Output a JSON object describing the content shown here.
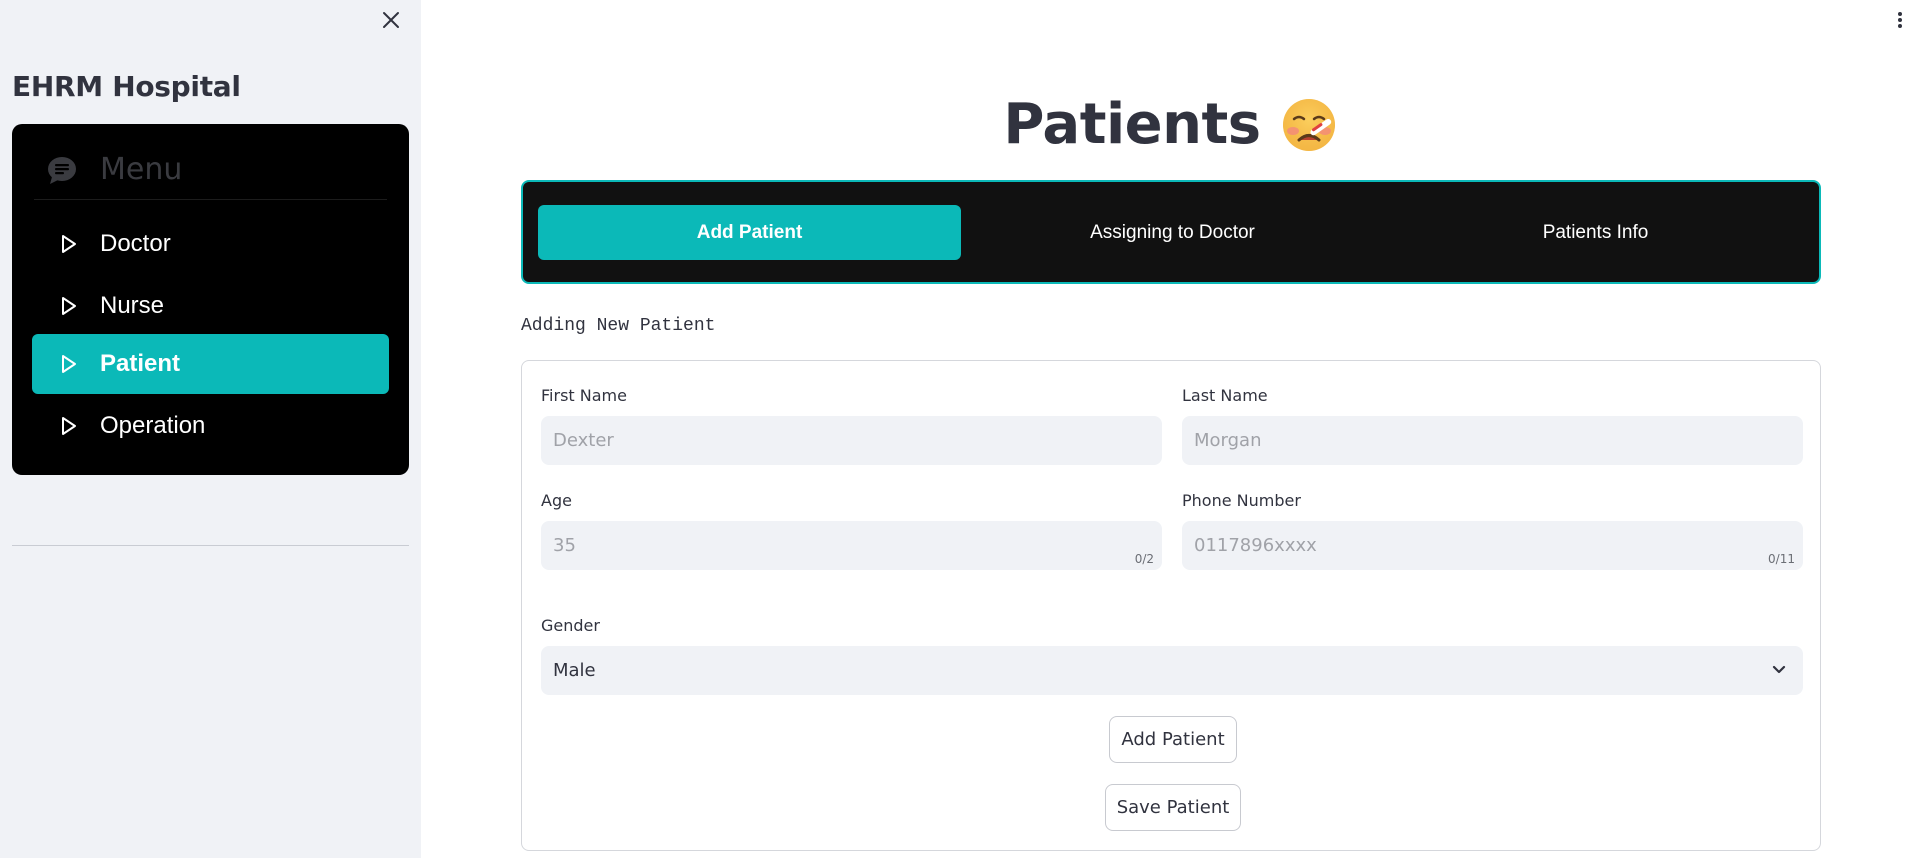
{
  "sidebar": {
    "brand": "EHRM Hospital",
    "menu_title": "Menu",
    "items": [
      {
        "label": "Doctor",
        "active": false
      },
      {
        "label": "Nurse",
        "active": false
      },
      {
        "label": "Patient",
        "active": true
      },
      {
        "label": "Operation",
        "active": false
      }
    ]
  },
  "header": {
    "title": "Patients",
    "emoji": "face-with-thermometer-icon"
  },
  "tabs": [
    {
      "label": "Add Patient",
      "active": true
    },
    {
      "label": "Assigning to Doctor",
      "active": false
    },
    {
      "label": "Patients Info",
      "active": false
    }
  ],
  "form": {
    "caption": "Adding New Patient",
    "first_name": {
      "label": "First Name",
      "placeholder": "Dexter"
    },
    "last_name": {
      "label": "Last Name",
      "placeholder": "Morgan"
    },
    "age": {
      "label": "Age",
      "placeholder": "35",
      "counter": "0/2"
    },
    "phone": {
      "label": "Phone Number",
      "placeholder": "0117896xxxx",
      "counter": "0/11"
    },
    "gender": {
      "label": "Gender",
      "value": "Male"
    },
    "add_button": "Add Patient",
    "save_button": "Save Patient"
  },
  "colors": {
    "accent": "#0bb9b8",
    "menu_bg": "#000000",
    "tab_bg": "#111111",
    "sidebar_bg": "#f0f2f6"
  }
}
